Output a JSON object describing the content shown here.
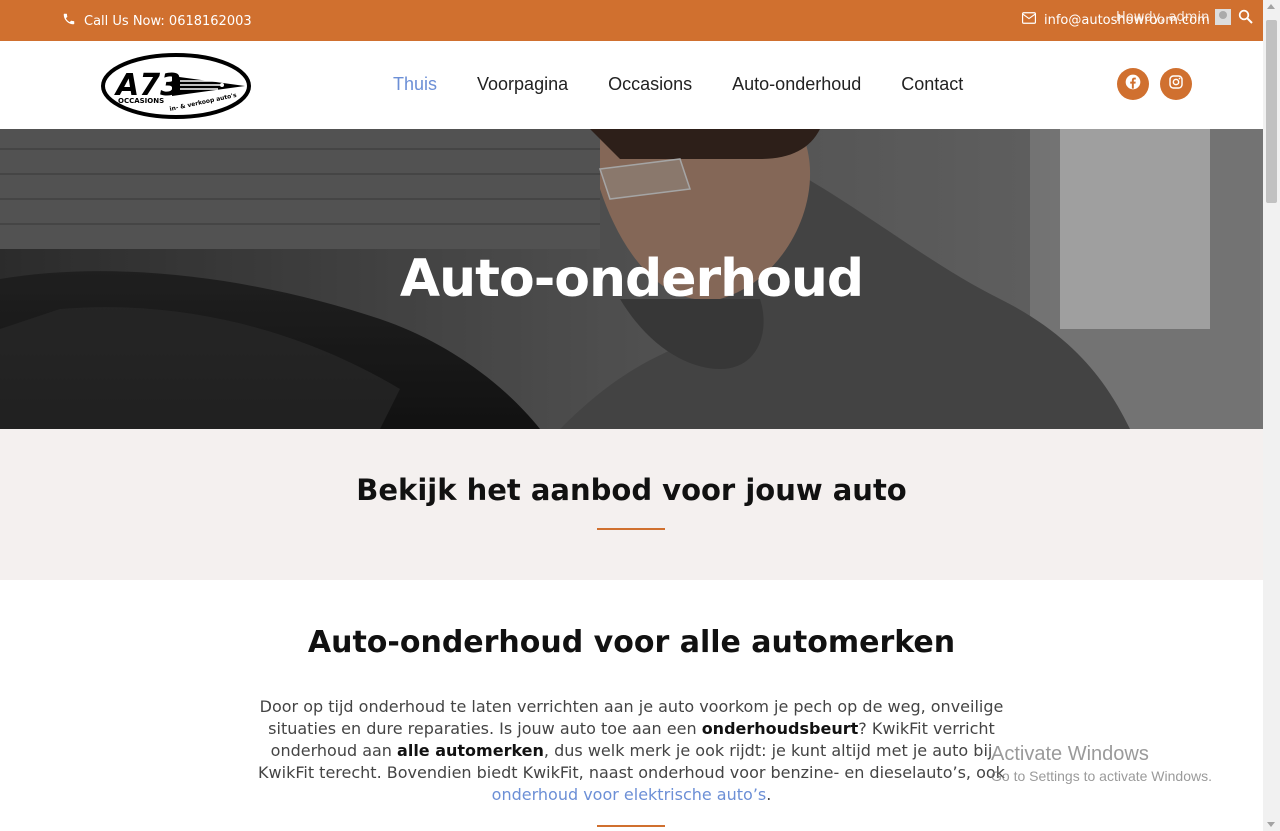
{
  "topbar": {
    "phone": "Call Us Now: 0618162003",
    "email": "info@autoshowroom.com",
    "howdy": "Howdy, admin",
    "bg_color": "#d0702f"
  },
  "logo": {
    "main": "A73",
    "sub": "OCCASIONS",
    "tagline": "in- & verkoop auto's"
  },
  "nav": {
    "items": [
      "Thuis",
      "Voorpagina",
      "Occasions",
      "Auto-onderhoud",
      "Contact"
    ],
    "active_index": 0
  },
  "social": {
    "icons": [
      "facebook-icon",
      "instagram-icon"
    ]
  },
  "hero": {
    "title": "Auto-onderhoud"
  },
  "band": {
    "title": "Bekijk het aanbod voor jouw auto"
  },
  "content": {
    "title": "Auto-onderhoud voor alle automerken",
    "p1": "Door op tijd onderhoud te laten verrichten aan je auto voorkom je pech op de weg, onveilige situaties en dure reparaties. Is jouw auto toe aan een ",
    "b1": "onderhoudsbeurt",
    "p2": "? KwikFit verricht onderhoud aan ",
    "b2": "alle automerken",
    "p3": ", dus welk merk je ook rijdt: je kunt altijd met je auto bij KwikFit terecht. Bovendien biedt KwikFit, naast onderhoud voor benzine- en dieselauto’s, ook ",
    "link": "onderhoud voor elektrische auto’s",
    "p4": "."
  },
  "watermark": {
    "line1": "Activate Windows",
    "line2": "Go to Settings to activate Windows."
  }
}
